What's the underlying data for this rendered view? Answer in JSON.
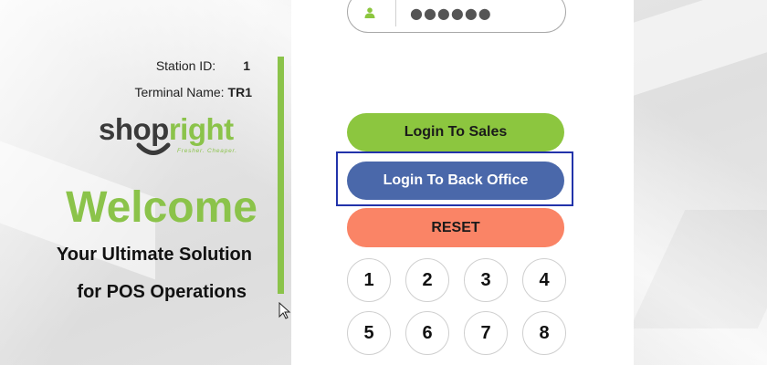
{
  "station": {
    "label": "Station ID:",
    "value": "1"
  },
  "terminal": {
    "label": "Terminal Name:",
    "value": "TR1"
  },
  "logo": {
    "text_main": "shop",
    "text_accent": "right",
    "tagline": "Fresher. Cheaper."
  },
  "welcome": {
    "title": "Welcome",
    "line1": "Your Ultimate Solution",
    "line2": "for POS Operations"
  },
  "password": {
    "value": "●●●●●●",
    "icon": "user-icon"
  },
  "buttons": {
    "sales": "Login To Sales",
    "back_office": "Login To Back Office",
    "reset": "RESET"
  },
  "keypad": [
    "1",
    "2",
    "3",
    "4",
    "5",
    "6",
    "7",
    "8"
  ],
  "colors": {
    "brand_green": "#8cc63f",
    "back_office_blue": "#4a68aa",
    "reset_salmon": "#fa8466"
  }
}
